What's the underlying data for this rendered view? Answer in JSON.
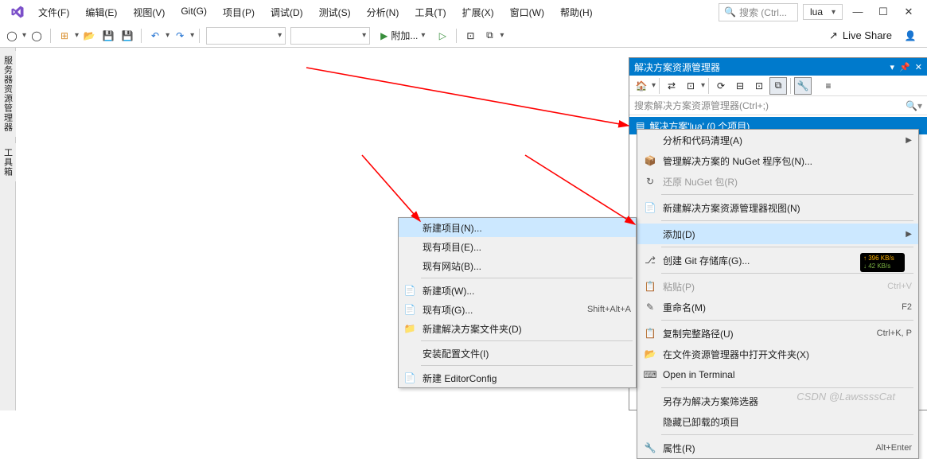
{
  "menubar": {
    "items": [
      "文件(F)",
      "编辑(E)",
      "视图(V)",
      "Git(G)",
      "项目(P)",
      "调试(D)",
      "测试(S)",
      "分析(N)",
      "工具(T)",
      "扩展(X)",
      "窗口(W)",
      "帮助(H)"
    ],
    "search_placeholder": "搜索 (Ctrl...",
    "combo_value": "lua"
  },
  "toolbar": {
    "attach_label": "附加...",
    "live_share": "Live Share"
  },
  "left_tabs": [
    "服务器资源管理器",
    "工具箱"
  ],
  "sln_explorer": {
    "title": "解决方案资源管理器",
    "search_placeholder": "搜索解决方案资源管理器(Ctrl+;)",
    "root_label": "解决方案'lua' (0 个项目)"
  },
  "ctx_a": {
    "items": [
      {
        "icon": "",
        "label": "新建项目(N)...",
        "shortcut": "",
        "selected": true
      },
      {
        "icon": "",
        "label": "现有项目(E)...",
        "shortcut": ""
      },
      {
        "icon": "",
        "label": "现有网站(B)...",
        "shortcut": ""
      },
      {
        "sep": true
      },
      {
        "icon": "📄",
        "label": "新建项(W)...",
        "shortcut": ""
      },
      {
        "icon": "📄",
        "label": "现有项(G)...",
        "shortcut": "Shift+Alt+A"
      },
      {
        "icon": "📁",
        "label": "新建解决方案文件夹(D)",
        "shortcut": ""
      },
      {
        "sep": true
      },
      {
        "icon": "",
        "label": "安装配置文件(I)",
        "shortcut": ""
      },
      {
        "sep": true
      },
      {
        "icon": "📄",
        "label": "新建 EditorConfig",
        "shortcut": ""
      }
    ]
  },
  "ctx_b": {
    "items": [
      {
        "icon": "",
        "label": "分析和代码清理(A)",
        "shortcut": "",
        "arrow": true
      },
      {
        "icon": "📦",
        "label": "管理解决方案的 NuGet 程序包(N)...",
        "shortcut": ""
      },
      {
        "icon": "↻",
        "label": "还原 NuGet 包(R)",
        "shortcut": "",
        "dis": true
      },
      {
        "sep": true
      },
      {
        "icon": "📄",
        "label": "新建解决方案资源管理器视图(N)",
        "shortcut": ""
      },
      {
        "sep": true
      },
      {
        "icon": "",
        "label": "添加(D)",
        "shortcut": "",
        "arrow": true,
        "selected": true
      },
      {
        "sep": true
      },
      {
        "icon": "⎇",
        "label": "创建 Git 存储库(G)...",
        "shortcut": ""
      },
      {
        "sep": true
      },
      {
        "icon": "📋",
        "label": "粘贴(P)",
        "shortcut": "Ctrl+V",
        "dis": true
      },
      {
        "icon": "✎",
        "label": "重命名(M)",
        "shortcut": "F2"
      },
      {
        "sep": true
      },
      {
        "icon": "📋",
        "label": "复制完整路径(U)",
        "shortcut": "Ctrl+K, P"
      },
      {
        "icon": "📂",
        "label": "在文件资源管理器中打开文件夹(X)",
        "shortcut": ""
      },
      {
        "icon": "⌨",
        "label": "Open in Terminal",
        "shortcut": ""
      },
      {
        "sep": true
      },
      {
        "icon": "",
        "label": "另存为解决方案筛选器",
        "shortcut": ""
      },
      {
        "icon": "",
        "label": "隐藏已卸载的项目",
        "shortcut": ""
      },
      {
        "sep": true
      },
      {
        "icon": "🔧",
        "label": "属性(R)",
        "shortcut": "Alt+Enter"
      }
    ]
  },
  "netspeed": {
    "up": "↑ 396 KB/s",
    "dn": "↓ 42 KB/s"
  },
  "watermark": "CSDN @LawssssCat"
}
